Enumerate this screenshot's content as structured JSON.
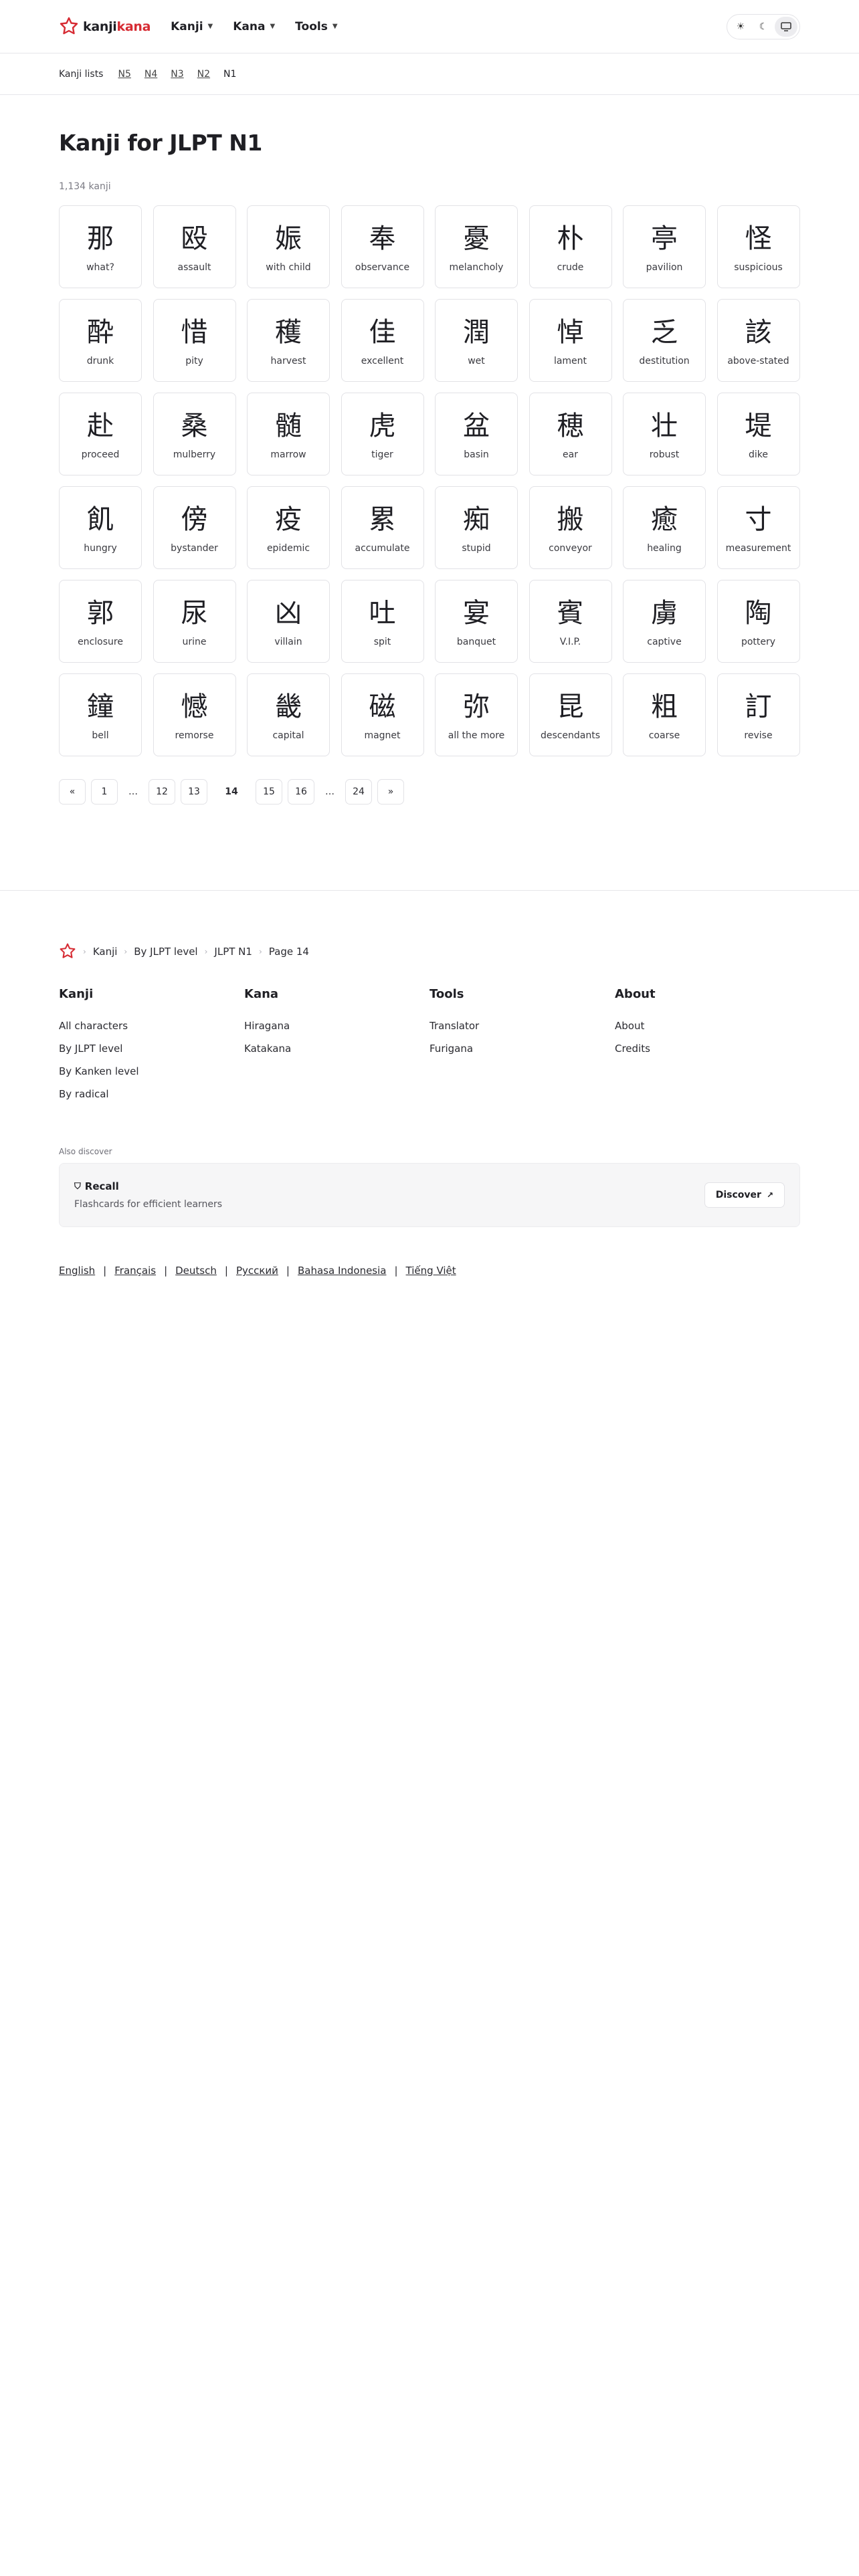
{
  "header": {
    "logo_part1": "kanji",
    "logo_part2": "kana",
    "nav": [
      {
        "label": "Kanji"
      },
      {
        "label": "Kana"
      },
      {
        "label": "Tools"
      }
    ],
    "theme_icons": [
      "sun-icon",
      "moon-icon",
      "monitor-icon"
    ]
  },
  "subnav": {
    "label": "Kanji lists",
    "levels": [
      "N5",
      "N4",
      "N3",
      "N2",
      "N1"
    ],
    "current": "N1"
  },
  "main": {
    "title": "Kanji for JLPT N1",
    "count": "1,134 kanji",
    "cards": [
      {
        "kanji": "那",
        "meaning": "what?"
      },
      {
        "kanji": "殴",
        "meaning": "assault"
      },
      {
        "kanji": "娠",
        "meaning": "with child"
      },
      {
        "kanji": "奉",
        "meaning": "observance"
      },
      {
        "kanji": "憂",
        "meaning": "melancholy"
      },
      {
        "kanji": "朴",
        "meaning": "crude"
      },
      {
        "kanji": "亭",
        "meaning": "pavilion"
      },
      {
        "kanji": "怪",
        "meaning": "suspicious"
      },
      {
        "kanji": "酔",
        "meaning": "drunk"
      },
      {
        "kanji": "惜",
        "meaning": "pity"
      },
      {
        "kanji": "穫",
        "meaning": "harvest"
      },
      {
        "kanji": "佳",
        "meaning": "excellent"
      },
      {
        "kanji": "潤",
        "meaning": "wet"
      },
      {
        "kanji": "悼",
        "meaning": "lament"
      },
      {
        "kanji": "乏",
        "meaning": "destitution"
      },
      {
        "kanji": "該",
        "meaning": "above-stated"
      },
      {
        "kanji": "赴",
        "meaning": "proceed"
      },
      {
        "kanji": "桑",
        "meaning": "mulberry"
      },
      {
        "kanji": "髄",
        "meaning": "marrow"
      },
      {
        "kanji": "虎",
        "meaning": "tiger"
      },
      {
        "kanji": "盆",
        "meaning": "basin"
      },
      {
        "kanji": "穂",
        "meaning": "ear"
      },
      {
        "kanji": "壮",
        "meaning": "robust"
      },
      {
        "kanji": "堤",
        "meaning": "dike"
      },
      {
        "kanji": "飢",
        "meaning": "hungry"
      },
      {
        "kanji": "傍",
        "meaning": "bystander"
      },
      {
        "kanji": "疫",
        "meaning": "epidemic"
      },
      {
        "kanji": "累",
        "meaning": "accumulate"
      },
      {
        "kanji": "痴",
        "meaning": "stupid"
      },
      {
        "kanji": "搬",
        "meaning": "conveyor"
      },
      {
        "kanji": "癒",
        "meaning": "healing"
      },
      {
        "kanji": "寸",
        "meaning": "measurement"
      },
      {
        "kanji": "郭",
        "meaning": "enclosure"
      },
      {
        "kanji": "尿",
        "meaning": "urine"
      },
      {
        "kanji": "凶",
        "meaning": "villain"
      },
      {
        "kanji": "吐",
        "meaning": "spit"
      },
      {
        "kanji": "宴",
        "meaning": "banquet"
      },
      {
        "kanji": "賓",
        "meaning": "V.I.P."
      },
      {
        "kanji": "虜",
        "meaning": "captive"
      },
      {
        "kanji": "陶",
        "meaning": "pottery"
      },
      {
        "kanji": "鐘",
        "meaning": "bell"
      },
      {
        "kanji": "憾",
        "meaning": "remorse"
      },
      {
        "kanji": "畿",
        "meaning": "capital"
      },
      {
        "kanji": "磁",
        "meaning": "magnet"
      },
      {
        "kanji": "弥",
        "meaning": "all the more"
      },
      {
        "kanji": "昆",
        "meaning": "descendants"
      },
      {
        "kanji": "粗",
        "meaning": "coarse"
      },
      {
        "kanji": "訂",
        "meaning": "revise"
      }
    ]
  },
  "pagination": {
    "items": [
      {
        "label": "«",
        "kind": "prev"
      },
      {
        "label": "1",
        "kind": "page"
      },
      {
        "label": "…",
        "kind": "ellipsis"
      },
      {
        "label": "12",
        "kind": "page"
      },
      {
        "label": "13",
        "kind": "page"
      },
      {
        "label": "14",
        "kind": "current"
      },
      {
        "label": "15",
        "kind": "page"
      },
      {
        "label": "16",
        "kind": "page"
      },
      {
        "label": "…",
        "kind": "ellipsis"
      },
      {
        "label": "24",
        "kind": "page"
      },
      {
        "label": "»",
        "kind": "next"
      }
    ]
  },
  "footer": {
    "breadcrumb": [
      "Kanji",
      "By JLPT level",
      "JLPT N1",
      "Page 14"
    ],
    "columns": [
      {
        "title": "Kanji",
        "links": [
          "All characters",
          "By JLPT level",
          "By Kanken level",
          "By radical"
        ]
      },
      {
        "title": "Kana",
        "links": [
          "Hiragana",
          "Katakana"
        ]
      },
      {
        "title": "Tools",
        "links": [
          "Translator",
          "Furigana"
        ]
      },
      {
        "title": "About",
        "links": [
          "About",
          "Credits"
        ]
      }
    ],
    "also_discover": "Also discover",
    "recall": {
      "title": "Recall",
      "description": "Flashcards for efficient learners",
      "button": "Discover"
    },
    "languages": [
      "English",
      "Français",
      "Deutsch",
      "Русский",
      "Bahasa Indonesia",
      "Tiếng Việt"
    ]
  },
  "colors": {
    "brand": "#d62b33",
    "border": "#e2e2e6",
    "text": "#1f1f24"
  }
}
